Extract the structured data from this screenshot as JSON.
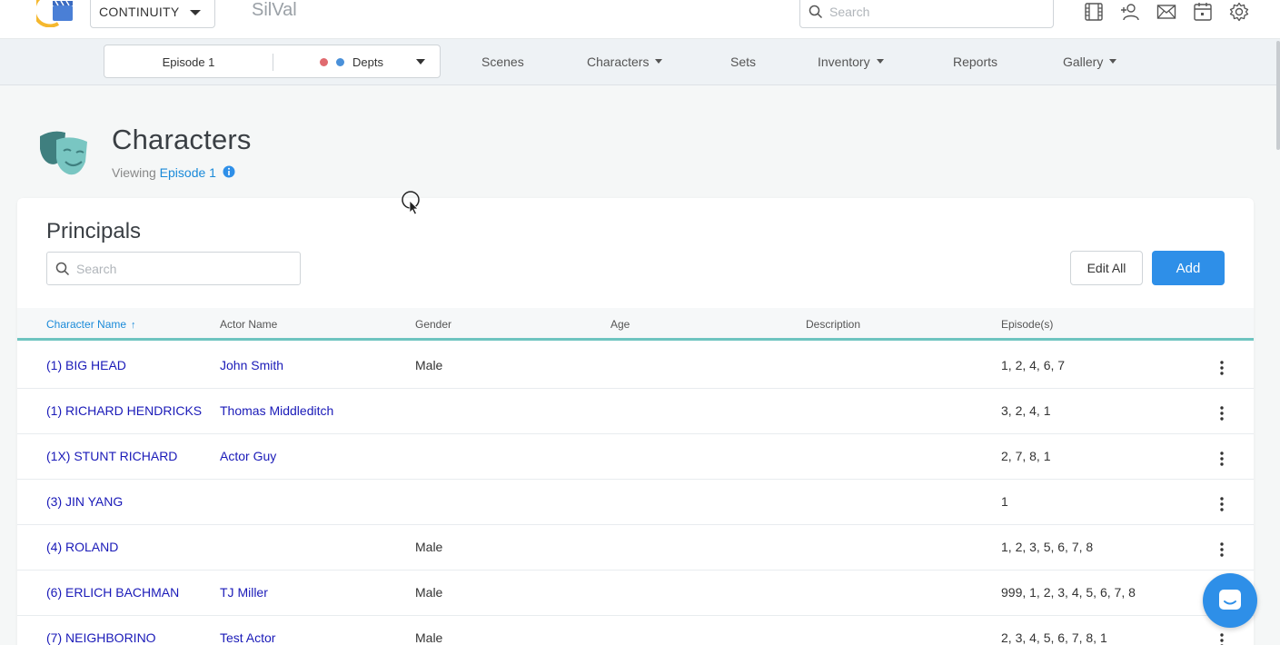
{
  "topbar": {
    "production": "CONTINUITY",
    "app_name": "SilVal",
    "search_placeholder": "Search",
    "icons": [
      "film-icon",
      "add-user-icon",
      "mail-icon",
      "calendar-icon",
      "settings-icon"
    ]
  },
  "navbar": {
    "episode": "Episode 1",
    "depts": "Depts",
    "dept_colors": [
      "#e06a6f",
      "#4a90d9"
    ],
    "items": [
      {
        "label": "Scenes",
        "has_menu": false
      },
      {
        "label": "Characters",
        "has_menu": true
      },
      {
        "label": "Sets",
        "has_menu": false
      },
      {
        "label": "Inventory",
        "has_menu": true
      },
      {
        "label": "Reports",
        "has_menu": false
      },
      {
        "label": "Gallery",
        "has_menu": true
      }
    ]
  },
  "page": {
    "title": "Characters",
    "viewing_prefix": "Viewing",
    "viewing_episode": "Episode 1"
  },
  "card": {
    "title": "Principals",
    "search_placeholder": "Search",
    "edit_all_label": "Edit All",
    "add_label": "Add"
  },
  "table": {
    "columns": [
      "Character Name",
      "Actor Name",
      "Gender",
      "Age",
      "Description",
      "Episode(s)"
    ],
    "sort_indicator": "↑",
    "rows": [
      {
        "character": "(1) BIG HEAD",
        "actor": "John Smith",
        "gender": "Male",
        "age": "",
        "description": "",
        "episodes": "1, 2, 4, 6, 7"
      },
      {
        "character": "(1) RICHARD HENDRICKS",
        "actor": "Thomas Middleditch",
        "gender": "",
        "age": "",
        "description": "",
        "episodes": "3, 2, 4, 1"
      },
      {
        "character": "(1X) STUNT RICHARD",
        "actor": "Actor Guy",
        "gender": "",
        "age": "",
        "description": "",
        "episodes": "2, 7, 8, 1"
      },
      {
        "character": "(3) JIN YANG",
        "actor": "",
        "gender": "",
        "age": "",
        "description": "",
        "episodes": "1"
      },
      {
        "character": "(4) ROLAND",
        "actor": "",
        "gender": "Male",
        "age": "",
        "description": "",
        "episodes": "1, 2, 3, 5, 6, 7, 8"
      },
      {
        "character": "(6) ERLICH BACHMAN",
        "actor": "TJ Miller",
        "gender": "Male",
        "age": "",
        "description": "",
        "episodes": "999, 1, 2, 3, 4, 5, 6, 7, 8"
      },
      {
        "character": "(7) NEIGHBORINO",
        "actor": "Test Actor",
        "gender": "Male",
        "age": "",
        "description": "",
        "episodes": "2, 3, 4, 5, 6, 7, 8, 1"
      }
    ]
  },
  "colors": {
    "accent": "#2e8fe8",
    "link": "#1a1ab8",
    "teal": "#6ec4c0"
  }
}
